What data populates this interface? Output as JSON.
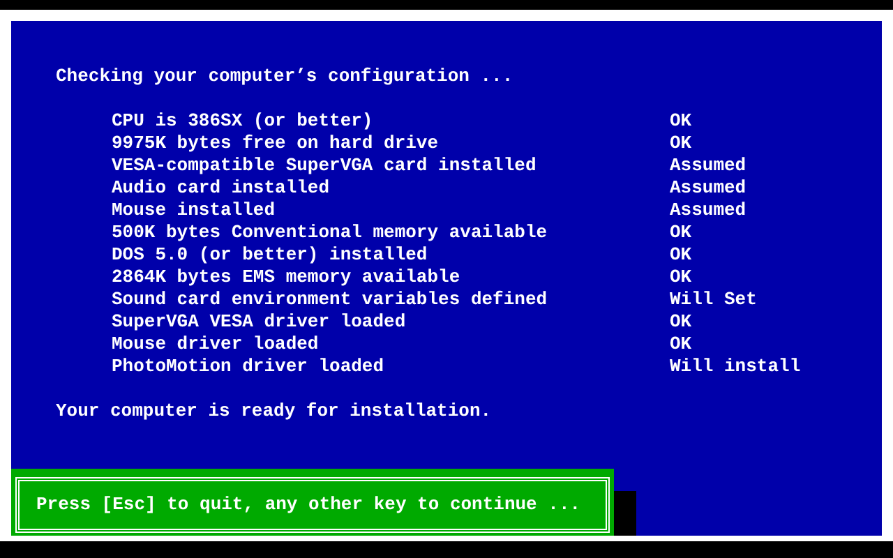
{
  "heading": "Checking your computer’s configuration ...",
  "checks": [
    {
      "item": "CPU is 386SX (or better)",
      "result": "OK"
    },
    {
      "item": "9975K bytes free on hard drive",
      "result": "OK"
    },
    {
      "item": "VESA-compatible SuperVGA card installed",
      "result": "Assumed"
    },
    {
      "item": "Audio card installed",
      "result": "Assumed"
    },
    {
      "item": "Mouse installed",
      "result": "Assumed"
    },
    {
      "item": "500K bytes Conventional memory available",
      "result": "OK"
    },
    {
      "item": "DOS 5.0 (or better) installed",
      "result": "OK"
    },
    {
      "item": "2864K bytes EMS memory available",
      "result": "OK"
    },
    {
      "item": "Sound card environment variables defined",
      "result": "Will Set"
    },
    {
      "item": "SuperVGA VESA driver loaded",
      "result": "OK"
    },
    {
      "item": "Mouse driver loaded",
      "result": "OK"
    },
    {
      "item": "PhotoMotion driver loaded",
      "result": "Will install"
    }
  ],
  "status_message": "Your computer is ready for installation.",
  "prompt": "Press [Esc] to quit, any other key to continue ..."
}
